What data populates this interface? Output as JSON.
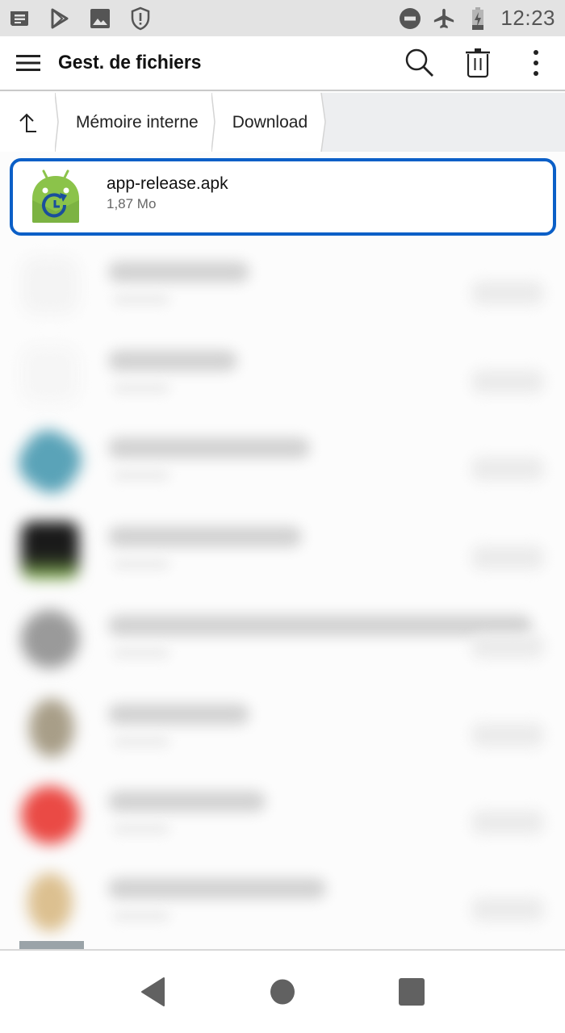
{
  "status_bar": {
    "left_icons": [
      "notification-message-icon",
      "play-store-icon",
      "gallery-image-icon",
      "shield-alert-icon"
    ],
    "right_icons": [
      "do-not-disturb-icon",
      "airplane-mode-icon",
      "battery-charging-icon"
    ],
    "time": "12:23"
  },
  "app_bar": {
    "menu_icon": "hamburger-menu-icon",
    "title": "Gest. de fichiers",
    "actions": [
      "search-icon",
      "trash-icon",
      "more-vert-icon"
    ]
  },
  "breadcrumb": {
    "up_icon": "arrow-up-icon",
    "items": [
      {
        "label": "Mémoire interne"
      },
      {
        "label": "Download"
      }
    ]
  },
  "file_list": {
    "selected": {
      "name": "app-release.apk",
      "size": "1,87 Mo",
      "icon": "android-apk-icon",
      "highlight_color": "#0b5fc7"
    },
    "blurred_items": [
      {
        "icon_color": "#f4f4f4"
      },
      {
        "icon_color": "#f6f6f6"
      },
      {
        "icon_color": "#3f8fa8"
      },
      {
        "icon_color": "#1a1a1a"
      },
      {
        "icon_color": "#8a8a8a"
      },
      {
        "icon_color": "#9a8f78"
      },
      {
        "icon_color": "#e53935"
      },
      {
        "icon_color": "#d8b880"
      }
    ]
  },
  "nav_bar": {
    "buttons": [
      "back-icon",
      "home-icon",
      "recents-icon"
    ]
  }
}
